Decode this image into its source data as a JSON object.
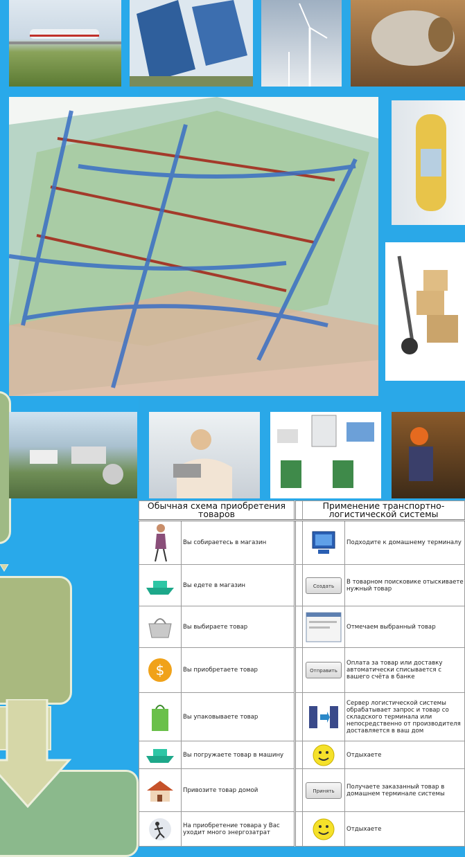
{
  "table": {
    "header_left": "Обычная схема приобретения товаров",
    "header_right": "Применение транспортно-логистической системы",
    "rows": [
      {
        "left": "Вы собираетесь в магазин",
        "right": "Подходите к домашнему терминалу",
        "left_icon": "woman-walking-icon",
        "right_icon": "computer-terminal-icon"
      },
      {
        "left": "Вы едете в магазин",
        "right": "В товарном поисковике отыскиваете нужный товар",
        "left_icon": "boat-icon",
        "right_icon": "create-button-icon",
        "right_btn": "Создать"
      },
      {
        "left": "Вы выбираете товар",
        "right": "Отмечаем выбранный товар",
        "left_icon": "shopping-basket-icon",
        "right_icon": "window-screenshot-icon"
      },
      {
        "left": "Вы приобретаете товар",
        "right": "Оплата за товар или доставку автоматически списывается с вашего счёта в банке",
        "left_icon": "dollar-coin-icon",
        "right_icon": "send-button-icon",
        "right_btn": "Отправить"
      },
      {
        "left": "Вы упаковываете товар",
        "right": "Сервер логистической системы обрабатывает запрос и товар со складского терминала или непосредственно от производителя доставляется в ваш дом",
        "left_icon": "recycle-bag-icon",
        "right_icon": "server-transfer-icon"
      },
      {
        "left": "Вы погружаете товар в машину",
        "right": "Отдыхаете",
        "left_icon": "boat-icon",
        "right_icon": "smiley-icon"
      },
      {
        "left": "Привозите товар домой",
        "right": "Получаете заказанный товар в домашнем терминале системы",
        "left_icon": "house-icon",
        "right_icon": "receive-button-icon",
        "right_btn": "Принять"
      },
      {
        "left": "На приобретение товара у Вас уходит много энергозатрат",
        "right": "Отдыхаете",
        "left_icon": "running-people-icon",
        "right_icon": "smiley-icon"
      }
    ]
  },
  "colors": {
    "background": "#29a9ea",
    "green_box": "#a9b97f",
    "arrow": "#d4d6a4",
    "pipe_blue": "#3a6fc4",
    "pipe_red": "#a33a2a"
  }
}
